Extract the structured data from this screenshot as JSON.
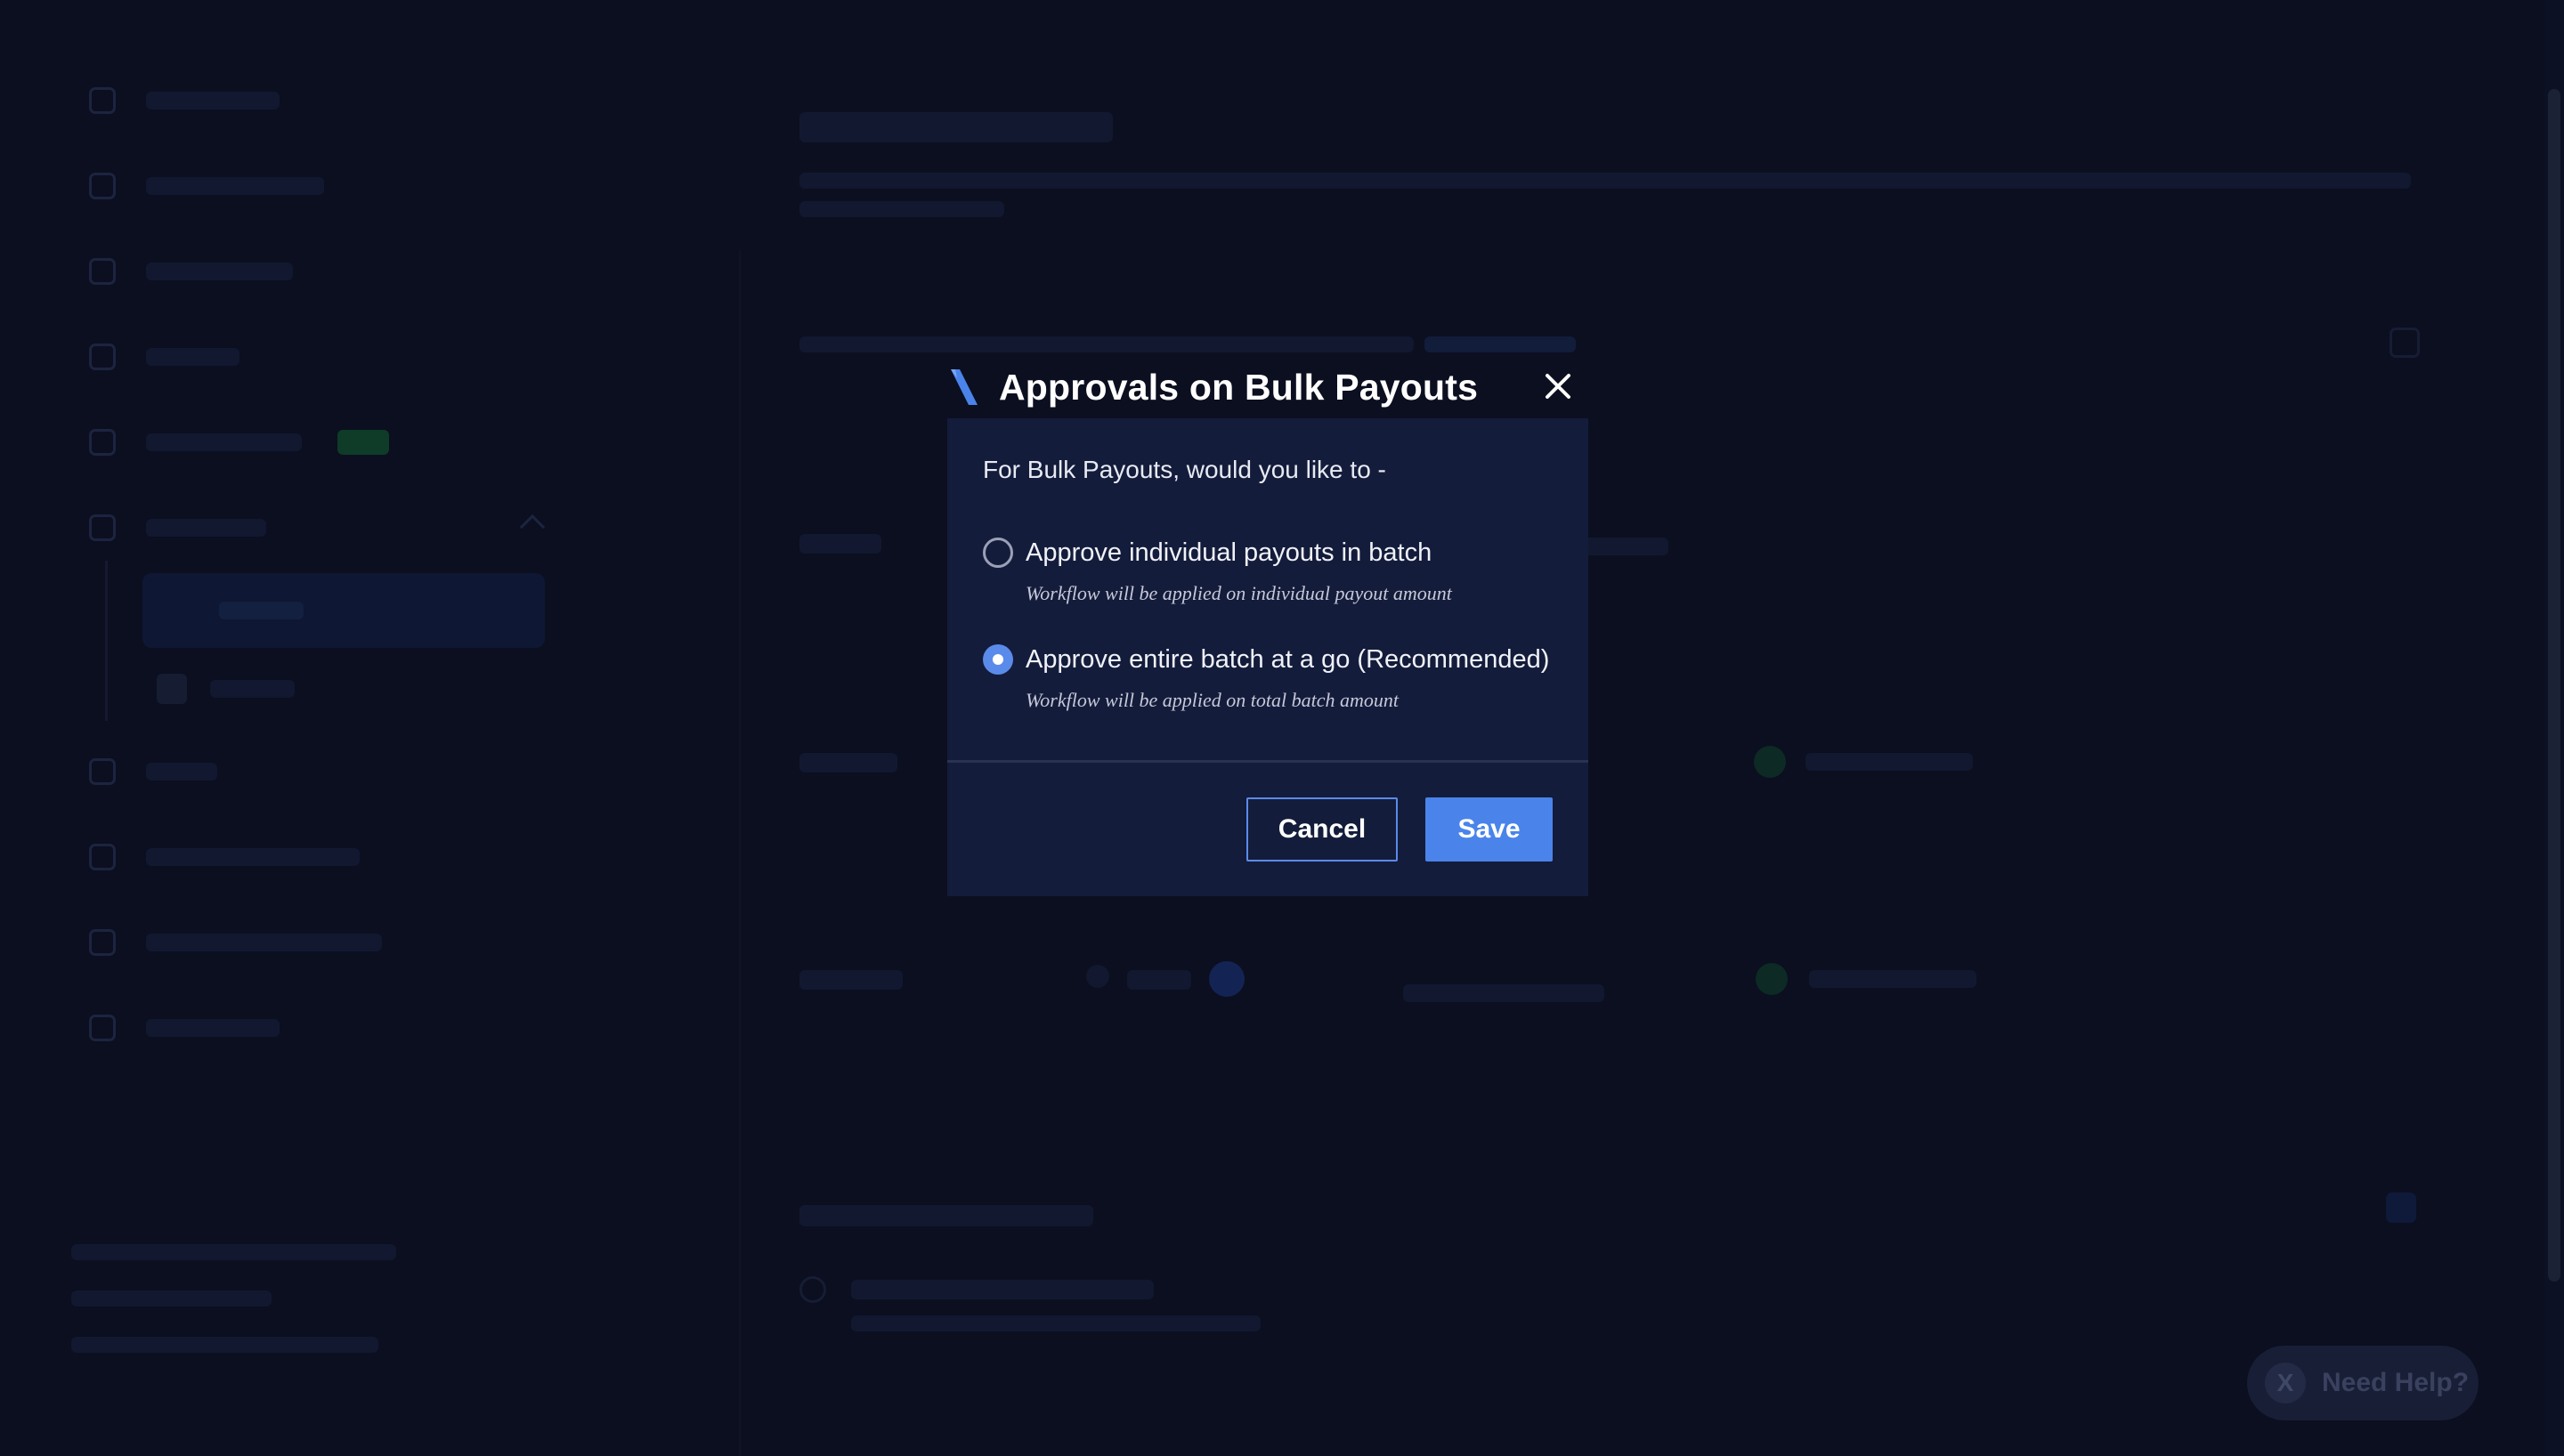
{
  "modal": {
    "title": "Approvals on Bulk Payouts",
    "question": "For Bulk Payouts, would you like to -",
    "options": [
      {
        "label": "Approve individual payouts in batch",
        "hint": "Workflow will be applied on individual payout amount",
        "selected": false
      },
      {
        "label": "Approve entire batch at a go (Recommended)",
        "hint": "Workflow will be applied on total batch amount",
        "selected": true
      }
    ],
    "cancel_label": "Cancel",
    "save_label": "Save",
    "close_icon": "close-icon",
    "accent_color": "#4a84ea"
  },
  "help": {
    "label": "Need Help?",
    "logo_glyph": "X"
  },
  "colors": {
    "background": "#0b0f20",
    "modal_background": "#141c3b",
    "primary_button": "#4a84ea"
  }
}
